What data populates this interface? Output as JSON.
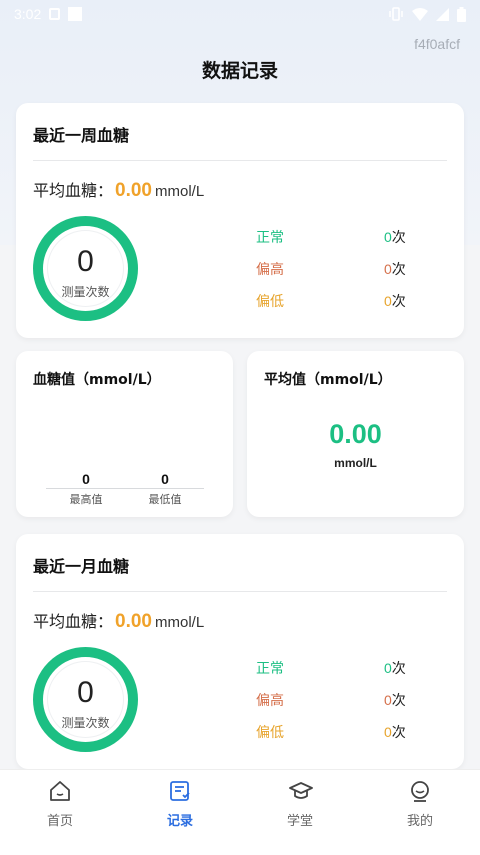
{
  "status_bar": {
    "time": "3:02"
  },
  "hex_label": "f4f0afcf",
  "page": {
    "title": "数据记录"
  },
  "week_card": {
    "title": "最近一周血糖",
    "avg_label": "平均血糖：",
    "avg_value": "0.00",
    "avg_unit": "mmol/L",
    "ring_count": "0",
    "ring_label": "测量次数",
    "stats": [
      {
        "label": "正常",
        "count": "0",
        "unit": "次"
      },
      {
        "label": "偏高",
        "count": "0",
        "unit": "次"
      },
      {
        "label": "偏低",
        "count": "0",
        "unit": "次"
      }
    ]
  },
  "glucose_card": {
    "title": "血糖值（mmol/L）",
    "max_value": "0",
    "max_label": "最高值",
    "min_value": "0",
    "min_label": "最低值"
  },
  "average_card": {
    "title": "平均值（mmol/L）",
    "value": "0.00",
    "unit": "mmol/L"
  },
  "month_card": {
    "title": "最近一月血糖",
    "avg_label": "平均血糖：",
    "avg_value": "0.00",
    "avg_unit": "mmol/L",
    "ring_count": "0",
    "ring_label": "测量次数",
    "stats": [
      {
        "label": "正常",
        "count": "0",
        "unit": "次"
      },
      {
        "label": "偏高",
        "count": "0",
        "unit": "次"
      },
      {
        "label": "偏低",
        "count": "0",
        "unit": "次"
      }
    ]
  },
  "colors": {
    "green": "#1cbf83",
    "orange": "#f0a22a",
    "high": "#d56f4a",
    "low": "#e7a42d",
    "active_tab": "#2c6ee0"
  },
  "tabbar": {
    "items": [
      {
        "label": "首页",
        "icon": "home-icon"
      },
      {
        "label": "记录",
        "icon": "record-icon"
      },
      {
        "label": "学堂",
        "icon": "graduation-cap-icon"
      },
      {
        "label": "我的",
        "icon": "face-icon"
      }
    ],
    "active": "记录"
  }
}
